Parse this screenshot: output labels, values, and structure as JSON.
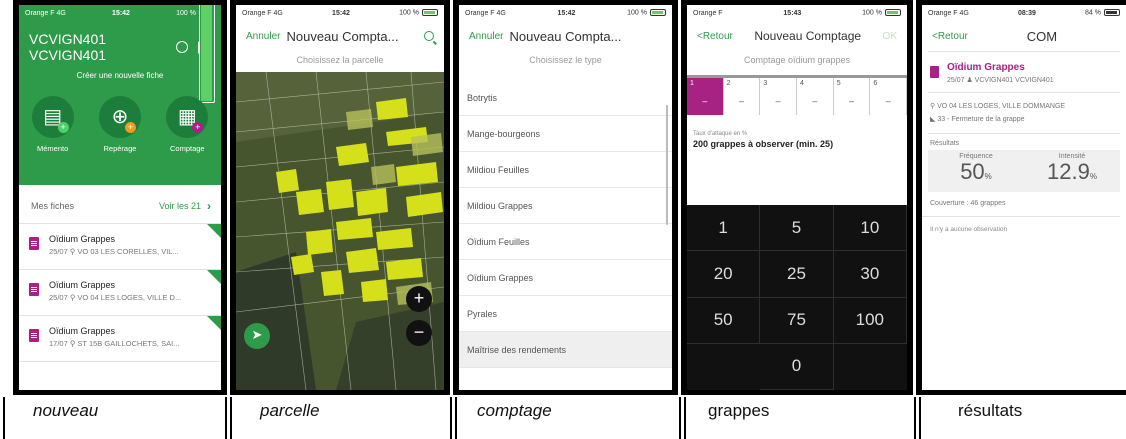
{
  "colors": {
    "green": "#2e9b4b",
    "purple": "#a72283",
    "keypad_bg": "#111111"
  },
  "screen1": {
    "status": {
      "carrier": "Orange F  4G",
      "time": "15:42",
      "battery": "100 %"
    },
    "user": "VCVIGN401 VCVIGN401",
    "icons": [
      "sync-icon",
      "qr-code-icon"
    ],
    "subtitle": "Créer une nouvelle fiche",
    "actions": [
      {
        "label": "Mémento",
        "icon": "memento-icon",
        "badge_color": "#4cd06b"
      },
      {
        "label": "Repérage",
        "icon": "crosshair-icon",
        "badge_color": "#f29a1c"
      },
      {
        "label": "Comptage",
        "icon": "calculator-icon",
        "badge_color": "#a72283"
      }
    ],
    "fiches_label": "Mes fiches",
    "see_all": "Voir les 21",
    "fiches": [
      {
        "title": "Oïdium Grappes",
        "meta": "25/07  ⚲ VO 03 LES CORELLES, VIL..."
      },
      {
        "title": "Oïdium Grappes",
        "meta": "25/07  ⚲ VO 04 LES LOGES, VILLE D..."
      },
      {
        "title": "Oïdium Grappes",
        "meta": "17/07  ⚲ ST 15B GAILLOCHETS, SAI..."
      }
    ]
  },
  "screen2": {
    "status": {
      "carrier": "Orange F  4G",
      "time": "15:42",
      "battery": "100 %"
    },
    "cancel": "Annuler",
    "title": "Nouveau Compta...",
    "subtitle": "Choisissez la parcelle"
  },
  "screen3": {
    "status": {
      "carrier": "Orange F  4G",
      "time": "15:42",
      "battery": "100 %"
    },
    "cancel": "Annuler",
    "title": "Nouveau Compta...",
    "subtitle": "Choisissez le type",
    "items": [
      "Botrytis",
      "Mange-bourgeons",
      "Mildiou Feuilles",
      "Mildiou Grappes",
      "Oïdium Feuilles",
      "Oïdium Grappes",
      "Pyrales",
      "Maîtrise des rendements"
    ]
  },
  "screen4": {
    "status": {
      "carrier": "Orange F",
      "time": "15:43",
      "battery": "100 %"
    },
    "back": "<Retour",
    "title": "Nouveau Comptage",
    "ok": "OK",
    "subtitle": "Comptage oïdium grappes",
    "tabs": [
      {
        "num": "1",
        "value": "–"
      },
      {
        "num": "2",
        "value": "–"
      },
      {
        "num": "3",
        "value": "–"
      },
      {
        "num": "4",
        "value": "–"
      },
      {
        "num": "5",
        "value": "–"
      },
      {
        "num": "6",
        "value": "–"
      }
    ],
    "taux_label": "Taux d'attaque en %",
    "observe": "200 grappes à observer (min. 25)",
    "keys": [
      "1",
      "5",
      "10",
      "20",
      "25",
      "30",
      "50",
      "75",
      "100",
      "0"
    ]
  },
  "screen5": {
    "status": {
      "carrier": "Orange F  4G",
      "time": "08:39",
      "battery": "84 %"
    },
    "back": "<Retour",
    "title": "COM",
    "fiche_title": "Oïdium Grappes",
    "fiche_meta": "25/07  ♟ VCVIGN401 VCVIGN401",
    "location": "⚲ VO 04 LES LOGES, VILLE DOMMANGE",
    "stade": "33 - Fermeture de la grappe",
    "results_label": "Résultats",
    "frequence_label": "Fréquence",
    "frequence_value": "50",
    "intensite_label": "Intensité",
    "intensite_value": "12.9",
    "unit": "%",
    "couverture": "Couverture : 46 grappes",
    "no_obs": "Il n'y a aucune observation"
  },
  "captions": [
    "nouveau",
    "parcelle",
    "comptage",
    "grappes",
    "résultats"
  ]
}
